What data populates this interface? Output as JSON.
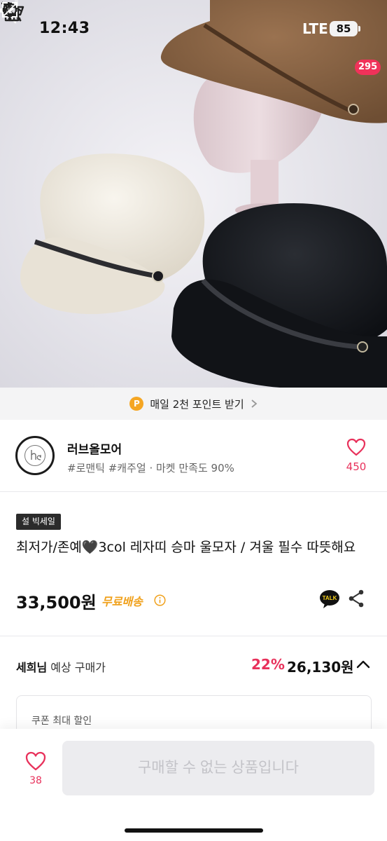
{
  "status_bar": {
    "time": "12:43",
    "network": "LTE",
    "battery": "85"
  },
  "top_nav": {
    "cart_badge": "295"
  },
  "points_banner": {
    "icon_letter": "P",
    "text": "매일 2천 포인트 받기"
  },
  "shop": {
    "name": "러브올모어",
    "tags": "#로맨틱 #캐주얼 · 마켓 만족도 90%",
    "likes": "450"
  },
  "product": {
    "badge": "설 빅세일",
    "title": "최저가/존예🖤3col 레자띠 승마 울모자 / 겨울 필수 따뜻해요",
    "price": "33,500원",
    "shipping": "무료배송"
  },
  "expected": {
    "user": "세희님",
    "label": "예상 구매가",
    "discount": "22%",
    "price": "26,130원"
  },
  "coupon": {
    "label": "쿠폰 최대 할인"
  },
  "bottom_bar": {
    "wish_count": "38",
    "buy_label": "구매할 수 없는 상품입니다"
  },
  "colors": {
    "accent_pink": "#e8315b",
    "shipping_orange": "#f0a11c",
    "badge_dark": "#2b2b2b"
  },
  "icons": [
    "bell-off-icon",
    "signal-icon",
    "back-arrow-icon",
    "home-icon",
    "search-icon",
    "cart-icon",
    "expand-icon",
    "heart-icon",
    "info-icon",
    "kakao-talk-icon",
    "share-icon",
    "chevron-up-icon",
    "chevron-right-icon"
  ]
}
